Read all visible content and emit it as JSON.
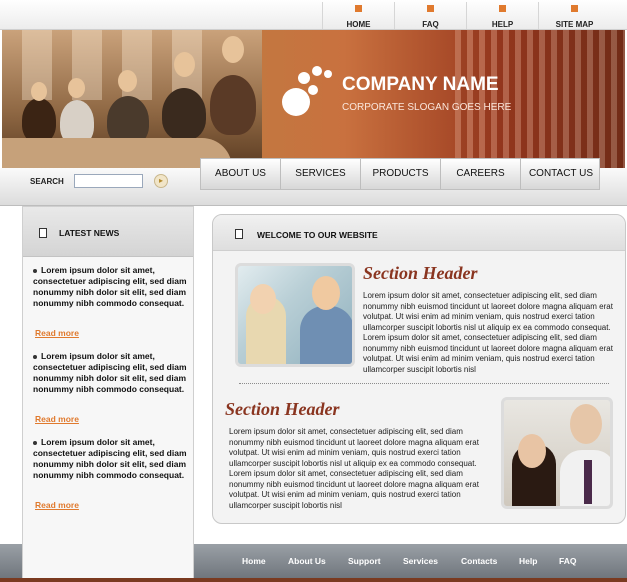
{
  "top_links": [
    {
      "label": "HOME"
    },
    {
      "label": "FAQ"
    },
    {
      "label": "HELP"
    },
    {
      "label": "SITE MAP"
    }
  ],
  "banner": {
    "company_name": "COMPANY NAME",
    "slogan": "CORPORATE SLOGAN GOES HERE"
  },
  "search": {
    "label": "SEARCH",
    "value": "",
    "button_icon": "arrow-icon"
  },
  "nav": [
    {
      "label": "ABOUT US"
    },
    {
      "label": "SERVICES"
    },
    {
      "label": "PRODUCTS"
    },
    {
      "label": "CAREERS"
    },
    {
      "label": "CONTACT US"
    }
  ],
  "sidebar": {
    "title": "LATEST NEWS",
    "items": [
      {
        "text": "Lorem ipsum dolor sit amet, consectetuer adipiscing elit, sed diam nonummy nibh dolor sit elit, sed diam nonummy nibh commodo consequat.",
        "read_more": "Read more"
      },
      {
        "text": "Lorem ipsum dolor sit amet, consectetuer adipiscing elit, sed diam nonummy nibh dolor sit elit, sed diam nonummy nibh commodo consequat.",
        "read_more": "Read more"
      },
      {
        "text": "Lorem ipsum dolor sit amet, consectetuer adipiscing elit, sed diam nonummy nibh dolor sit elit, sed diam nonummy nibh commodo consequat.",
        "read_more": "Read more"
      }
    ]
  },
  "main": {
    "title": "WELCOME TO OUR WEBSITE",
    "sections": [
      {
        "header": "Section Header",
        "body": "Lorem ipsum dolor sit amet, consectetuer adipiscing elit, sed diam nonummy nibh euismod tincidunt ut laoreet dolore magna aliquam erat volutpat. Ut wisi enim ad minim veniam, quis nostrud exerci tation ullamcorper suscipit lobortis nisl ut aliquip ex ea commodo consequat. Lorem ipsum dolor sit amet, consectetuer adipiscing elit, sed diam nonummy nibh euismod tincidunt ut laoreet dolore magna aliquam erat volutpat. Ut wisi enim ad minim veniam, quis nostrud exerci tation ullamcorper suscipit lobortis nisl"
      },
      {
        "header": "Section Header",
        "body": "Lorem ipsum dolor sit amet, consectetuer adipiscing elit, sed diam nonummy nibh euismod tincidunt ut laoreet dolore magna aliquam erat volutpat. Ut wisi enim ad minim veniam, quis nostrud exerci tation ullamcorper suscipit lobortis nisl ut aliquip ex ea commodo consequat. Lorem ipsum dolor sit amet, consectetuer adipiscing elit, sed diam nonummy nibh euismod tincidunt ut laoreet dolore magna aliquam erat volutpat. Ut wisi enim ad minim veniam, quis nostrud exerci tation ullamcorper suscipit lobortis nisl"
      }
    ]
  },
  "footer": [
    {
      "label": "Home"
    },
    {
      "label": "About Us"
    },
    {
      "label": "Support"
    },
    {
      "label": "Services"
    },
    {
      "label": "Contacts"
    },
    {
      "label": "Help"
    },
    {
      "label": "FAQ"
    }
  ],
  "colors": {
    "accent": "#e07a2e",
    "header_text": "#8a3520"
  }
}
